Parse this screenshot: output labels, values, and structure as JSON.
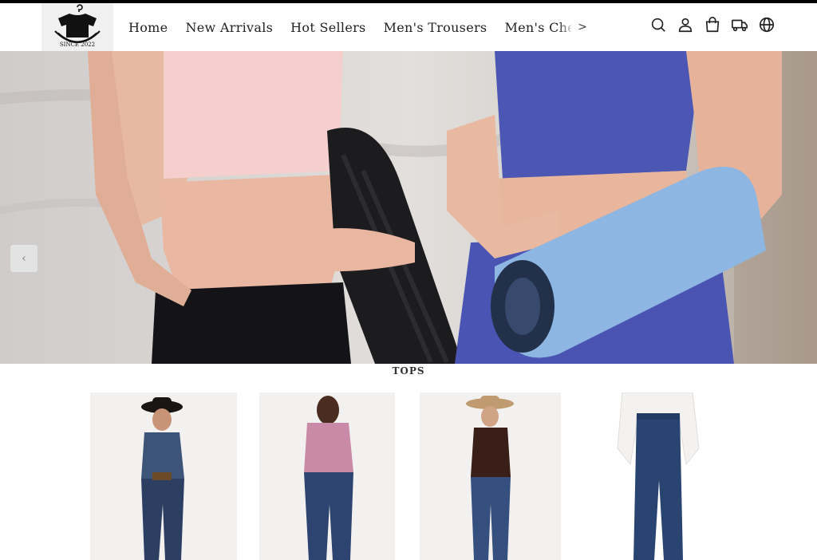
{
  "brand": {
    "logo_text": "SINCE 2022"
  },
  "nav": {
    "items": [
      {
        "label": "Home"
      },
      {
        "label": "New Arrivals"
      },
      {
        "label": "Hot Sellers"
      },
      {
        "label": "Men's Trousers"
      },
      {
        "label": "Men's Chelsea Boots"
      }
    ],
    "more_label": ">"
  },
  "header_icons": [
    "search-icon",
    "account-icon",
    "cart-icon",
    "order-tracking-icon",
    "language-icon"
  ],
  "hero": {
    "prev_label": "‹"
  },
  "section": {
    "title": "TOPS"
  },
  "colors": {
    "top_bar": "#000000",
    "denim": "#2e4a78",
    "pink_top": "#f3cccb",
    "blue_top": "#4a56b0",
    "mat_blue": "#8fb7e0"
  }
}
